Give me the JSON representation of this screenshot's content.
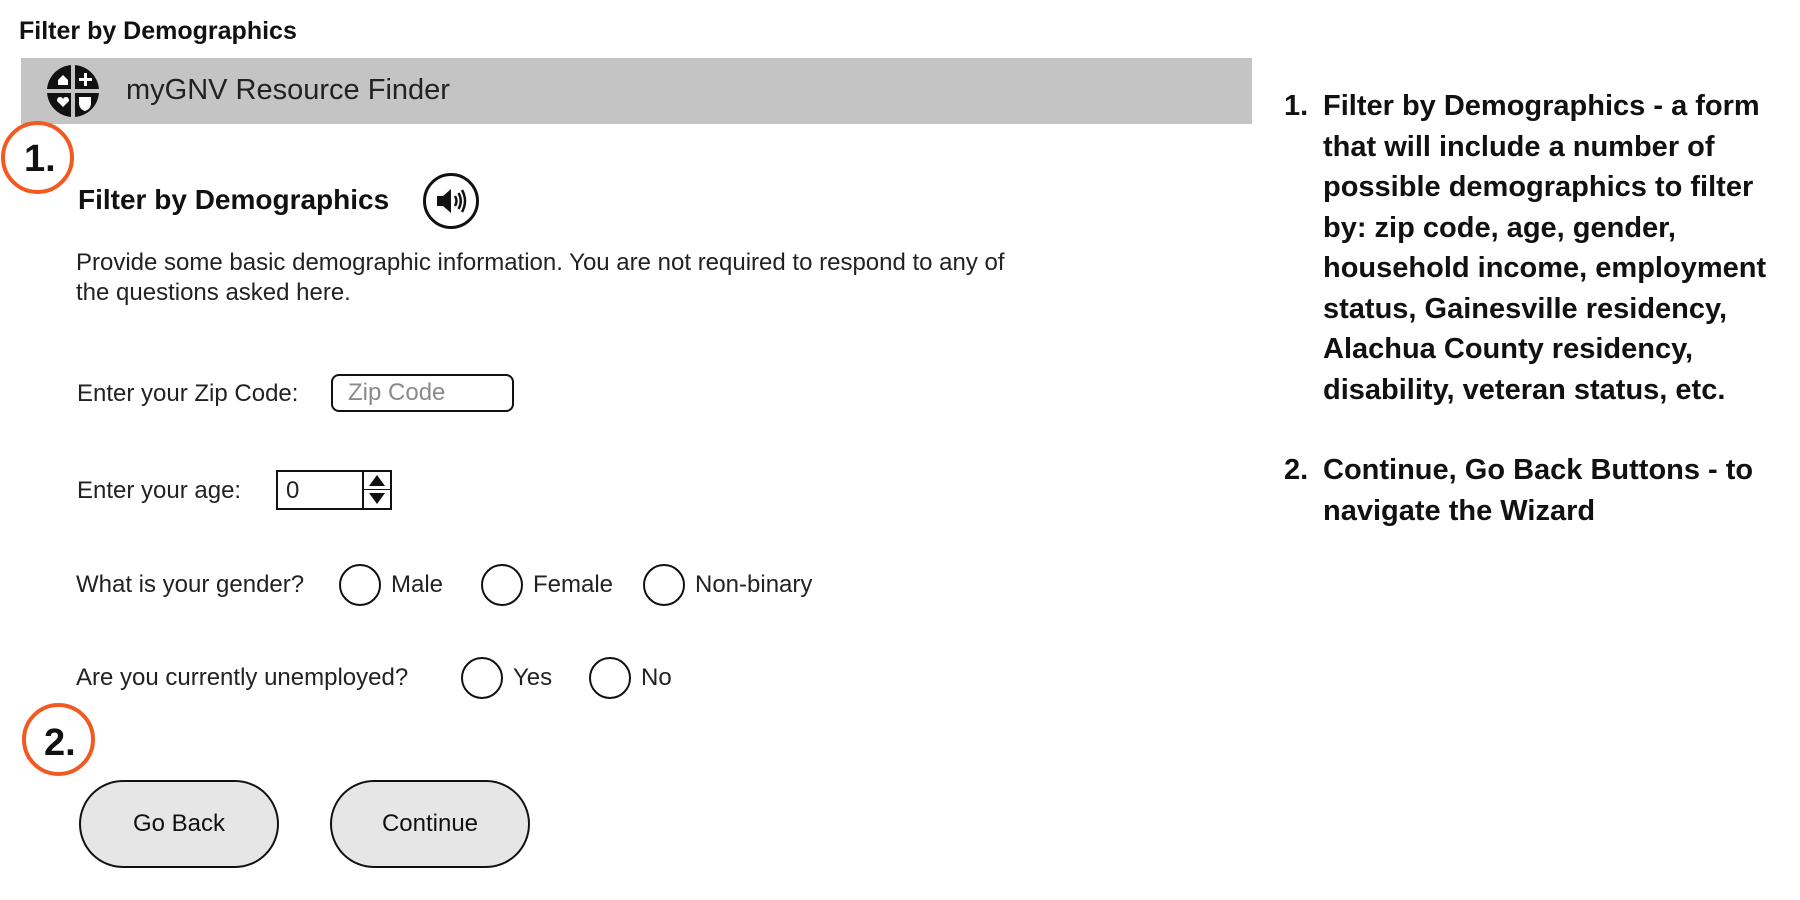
{
  "page": {
    "title": "Filter by Demographics"
  },
  "header": {
    "app_name": "myGNV Resource Finder",
    "logo_icon": "quadrant-cross-logo-icon"
  },
  "callouts": {
    "one": "1.",
    "two": "2."
  },
  "form": {
    "title": "Filter by Demographics",
    "speaker_icon": "speaker-icon",
    "intro": "Provide some basic demographic information. You are not required to respond to any of the questions asked here.",
    "zip": {
      "label": "Enter your Zip Code:",
      "placeholder": "Zip Code",
      "value": ""
    },
    "age": {
      "label": "Enter your age:",
      "value": "0"
    },
    "gender": {
      "label": "What is your gender?",
      "options": [
        "Male",
        "Female",
        "Non-binary"
      ]
    },
    "unemployed": {
      "label": "Are you currently unemployed?",
      "options": [
        "Yes",
        "No"
      ]
    }
  },
  "buttons": {
    "back_label": "Go Back",
    "continue_label": "Continue"
  },
  "notes": [
    {
      "num": "1.",
      "text": "Filter by Demographics - a form that will include a number of possible demographics to filter by: zip code, age, gender, household income, employment status, Gainesville residency, Alachua County residency, disability, veteran status, etc."
    },
    {
      "num": "2.",
      "text": "Continue, Go Back Buttons - to navigate the Wizard"
    }
  ],
  "colors": {
    "header_bg": "#c4c4c4",
    "callout_ring": "#f25a22",
    "button_bg": "#e6e6e6"
  }
}
